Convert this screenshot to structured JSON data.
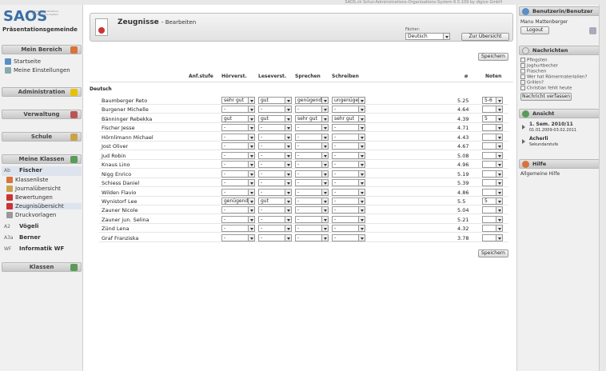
{
  "topbar": "SAOS.ch Schul-Administrations-Organisations-System 6.5.109 by digivo GmbH",
  "logo": "SAOS",
  "logo_sub": "Schul-Administrations-Organisations-System",
  "gemeinde": "Präsentationsgemeinde",
  "left": {
    "mein_bereich": "Mein Bereich",
    "startseite": "Startseite",
    "einstellungen": "Meine Einstellungen",
    "administration": "Administration",
    "verwaltung": "Verwaltung",
    "schule": "Schule",
    "meine_klassen": "Meine Klassen",
    "klassen": "Klassen",
    "classes": [
      {
        "code": "Ab",
        "name": "Fischer"
      },
      {
        "code": "A2",
        "name": "Vögeli"
      },
      {
        "code": "A3a",
        "name": "Berner"
      },
      {
        "code": "WF",
        "name": "Informatik WF"
      }
    ],
    "sub_links": [
      "Klassenliste",
      "Journalübersicht",
      "Bewertungen",
      "Zeugnisübersicht",
      "Druckvorlagen"
    ]
  },
  "main": {
    "title": "Zeugnisse",
    "subtitle": "- Bearbeiten",
    "faecher_label": "Fächer:",
    "faecher_value": "Deutsch",
    "overview_button": "Zur Übersicht",
    "save_button": "Speichern",
    "section": "Deutsch",
    "headers": [
      "Anf.stufe",
      "Hörverst.",
      "Leseverst.",
      "Sprechen",
      "Schreiben",
      "ø",
      "Noten"
    ],
    "rows": [
      {
        "name": "Baumberger Reto",
        "h": "sehr gut",
        "l": "gut",
        "s": "genügend",
        "w": "ungenügend",
        "avg": "5.25",
        "note": "5-6"
      },
      {
        "name": "Burgener Michelle",
        "h": "-",
        "l": "-",
        "s": "-",
        "w": "-",
        "avg": "4.64",
        "note": ""
      },
      {
        "name": "Bänninger Rebekka",
        "h": "gut",
        "l": "gut",
        "s": "sehr gut",
        "w": "sehr gut",
        "avg": "4.39",
        "note": "5"
      },
      {
        "name": "Fischer Jesse",
        "h": "-",
        "l": "-",
        "s": "-",
        "w": "-",
        "avg": "4.71",
        "note": ""
      },
      {
        "name": "Hörnlimann Michael",
        "h": "-",
        "l": "-",
        "s": "-",
        "w": "-",
        "avg": "4.43",
        "note": ""
      },
      {
        "name": "Jost Oliver",
        "h": "-",
        "l": "-",
        "s": "-",
        "w": "-",
        "avg": "4.67",
        "note": ""
      },
      {
        "name": "Jud Robin",
        "h": "-",
        "l": "-",
        "s": "-",
        "w": "-",
        "avg": "5.08",
        "note": ""
      },
      {
        "name": "Knaus Lino",
        "h": "-",
        "l": "-",
        "s": "-",
        "w": "-",
        "avg": "4.96",
        "note": ""
      },
      {
        "name": "Nigg Enrico",
        "h": "-",
        "l": "-",
        "s": "-",
        "w": "-",
        "avg": "5.19",
        "note": ""
      },
      {
        "name": "Schiess Daniel",
        "h": "-",
        "l": "-",
        "s": "-",
        "w": "-",
        "avg": "5.39",
        "note": ""
      },
      {
        "name": "Wilden Flavio",
        "h": "-",
        "l": "-",
        "s": "-",
        "w": "-",
        "avg": "4.86",
        "note": ""
      },
      {
        "name": "Wynistorf Lee",
        "h": "genügend",
        "l": "gut",
        "s": "-",
        "w": "-",
        "avg": "5.5",
        "note": "5"
      },
      {
        "name": "Zauner Nicole",
        "h": "-",
        "l": "-",
        "s": "-",
        "w": "-",
        "avg": "5.04",
        "note": ""
      },
      {
        "name": "Zauner jun. Selina",
        "h": "-",
        "l": "-",
        "s": "-",
        "w": "-",
        "avg": "5.21",
        "note": ""
      },
      {
        "name": "Zünd Lena",
        "h": "-",
        "l": "-",
        "s": "-",
        "w": "-",
        "avg": "4.32",
        "note": ""
      },
      {
        "name": "Graf Franziska",
        "h": "-",
        "l": "-",
        "s": "-",
        "w": "-",
        "avg": "3.78",
        "note": ""
      }
    ]
  },
  "right": {
    "user_title": "Benutzerin/Benutzer",
    "user_name": "Manu Mattenberger",
    "logout": "Logout",
    "news_title": "Nachrichten",
    "news": [
      "Pfingsten",
      "Joghurtbecher",
      "Flaschen",
      "Wer hat Römermaterialien?",
      "Grillen?",
      "Christian fehlt heute"
    ],
    "news_button": "Nachricht verfassen",
    "ansicht_title": "Ansicht",
    "semester": "1. Sem. 2010/11",
    "semester_dates": "01.01.2009-03.02.2011",
    "school": "Acherli",
    "level": "Sekundarstufe",
    "hilfe_title": "Hilfe",
    "hilfe_text": "Allgemeine Hilfe"
  }
}
